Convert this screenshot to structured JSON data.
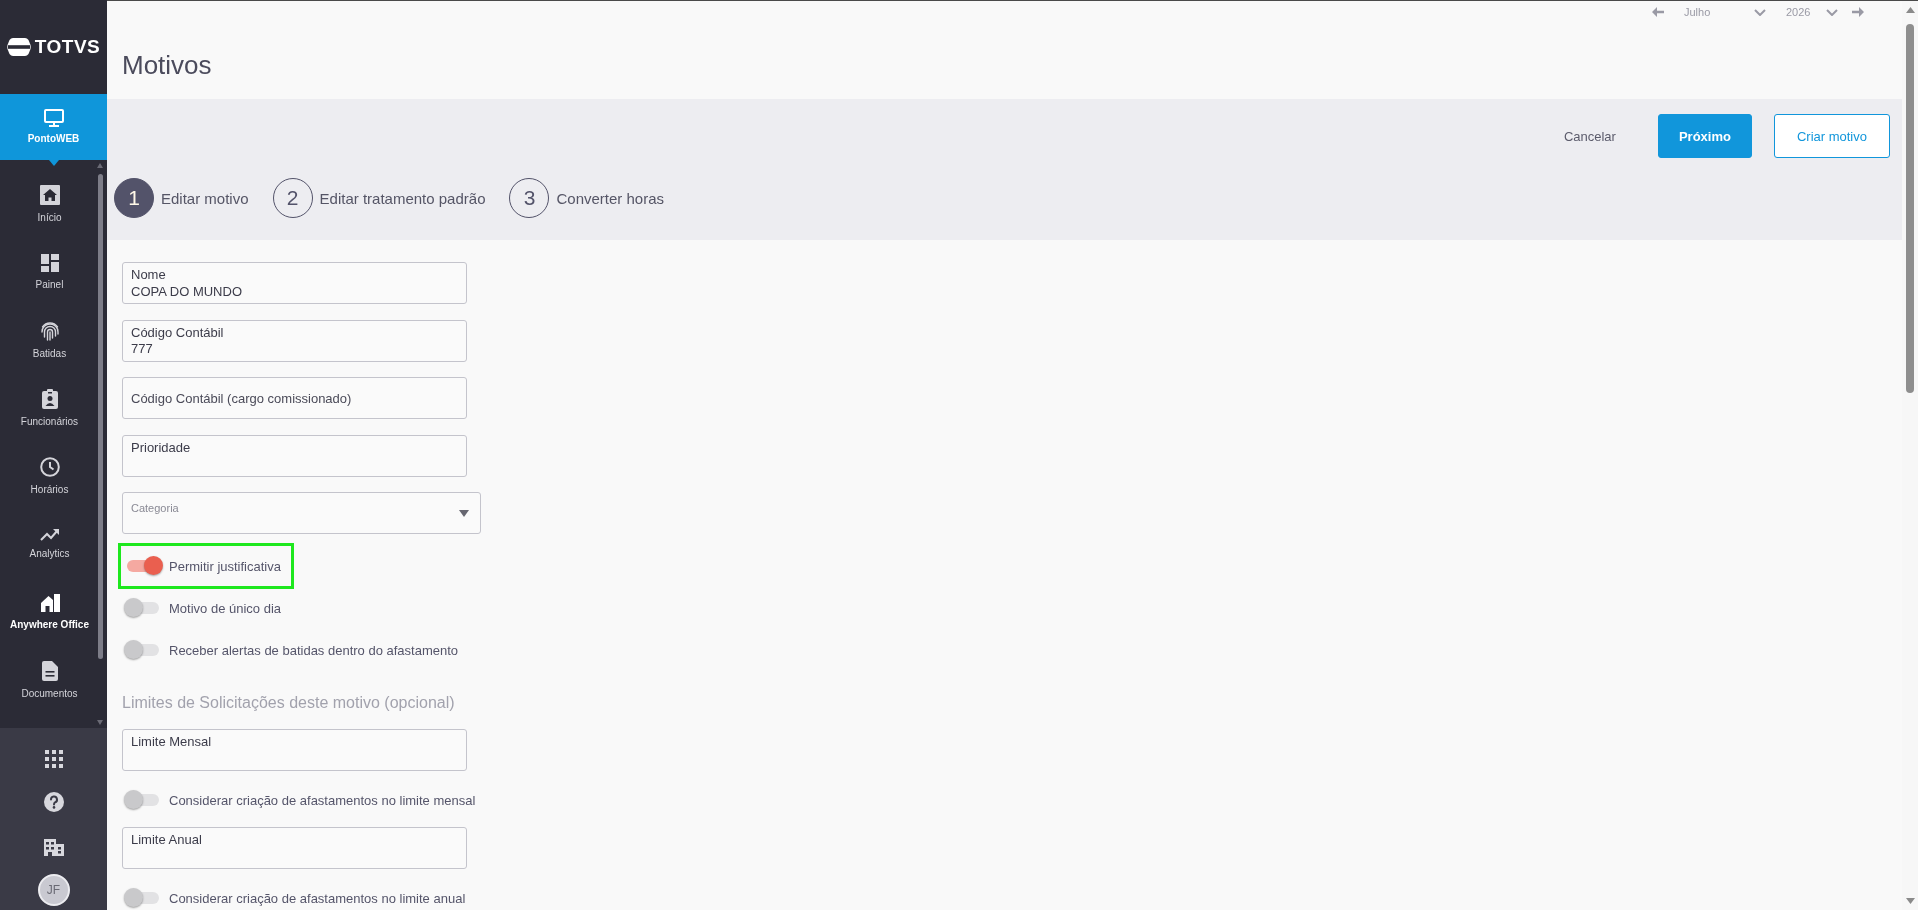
{
  "sidebar": {
    "logo": "TOTVS",
    "module": {
      "label": "PontoWEB",
      "selected": true
    },
    "items": [
      {
        "label": "Início",
        "selected": false,
        "emphasized": false
      },
      {
        "label": "Painel",
        "selected": false,
        "emphasized": false
      },
      {
        "label": "Batidas",
        "selected": false,
        "emphasized": false
      },
      {
        "label": "Funcionários",
        "selected": false,
        "emphasized": false
      },
      {
        "label": "Horários",
        "selected": false,
        "emphasized": false
      },
      {
        "label": "Analytics",
        "selected": false,
        "emphasized": false
      },
      {
        "label": "Anywhere Office",
        "selected": false,
        "emphasized": true
      },
      {
        "label": "Documentos",
        "selected": false,
        "emphasized": false
      }
    ],
    "user_initials": "JF"
  },
  "date_nav": {
    "month": "Julho",
    "year": "2026"
  },
  "header": {
    "title": "Motivos"
  },
  "actions": [
    {
      "kind": "text",
      "label": "Cancelar"
    },
    {
      "kind": "primary",
      "label": "Próximo"
    },
    {
      "kind": "outline",
      "label": "Criar motivo"
    }
  ],
  "steps": [
    {
      "number": "1",
      "label": "Editar motivo",
      "selected": true
    },
    {
      "number": "2",
      "label": "Editar tratamento padrão",
      "selected": false
    },
    {
      "number": "3",
      "label": "Converter horas",
      "selected": false
    }
  ],
  "form": [
    {
      "kind": "text",
      "label": "Nome",
      "value": "COPA DO MUNDO"
    },
    {
      "kind": "text",
      "label": "Código Contábil",
      "value": "777"
    },
    {
      "kind": "text",
      "placeholder": "Código Contábil (cargo comissionado)"
    },
    {
      "kind": "text",
      "label": "Prioridade"
    },
    {
      "kind": "select",
      "label": "Categoria"
    },
    {
      "kind": "toggle",
      "label": "Permitir justificativa",
      "on": true,
      "highlighted": true
    },
    {
      "kind": "toggle",
      "label": "Motivo de único dia",
      "on": false,
      "highlighted": false
    },
    {
      "kind": "toggle",
      "label": "Receber alertas de batidas dentro do afastamento",
      "on": false,
      "highlighted": false
    },
    {
      "kind": "heading",
      "text": "Limites de Solicitações deste motivo (opcional)"
    },
    {
      "kind": "text",
      "label": "Limite Mensal"
    },
    {
      "kind": "toggle",
      "label": "Considerar criação de afastamentos no limite mensal",
      "on": false,
      "highlighted": false
    },
    {
      "kind": "text",
      "label": "Limite Anual"
    },
    {
      "kind": "toggle",
      "label": "Considerar criação de afastamentos no limite anual",
      "on": false,
      "highlighted": false
    }
  ]
}
